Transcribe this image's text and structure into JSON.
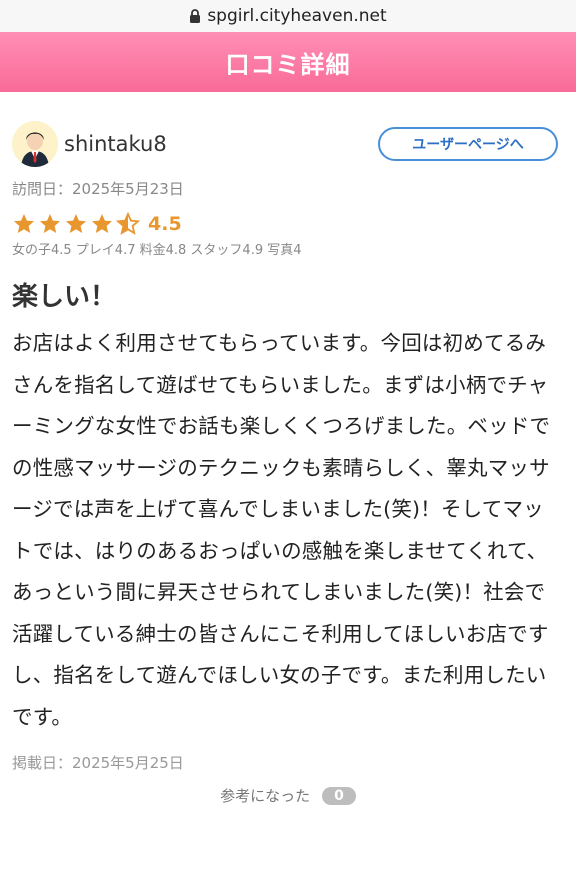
{
  "browser": {
    "url": "spgirl.cityheaven.net"
  },
  "header": {
    "title": "口コミ詳細"
  },
  "review": {
    "username": "shintaku8",
    "userpage_button": "ユーザーページへ",
    "visit_date": "訪問日：2025年5月23日",
    "rating": "4.5",
    "rating_value": 4.5,
    "subscores": "女の子4.5 プレイ4.7 料金4.8 スタッフ4.9 写真4",
    "title": "楽しい！",
    "body": "お店はよく利用させてもらっています。今回は初めてるみさんを指名して遊ばせてもらいました。まずは小柄でチャーミングな女性でお話も楽しくくつろげました。ベッドでの性感マッサージのテクニックも素晴らしく、睾丸マッサージでは声を上げて喜んでしまいました(笑)！そしてマットでは、はりのあるおっぱいの感触を楽しませてくれて、あっという間に昇天させられてしまいました(笑)！社会で活躍している紳士の皆さんにこそ利用してほしいお店ですし、指名をして遊んでほしい女の子です。また利用したいです。",
    "posted_date": "掲載日：2025年5月25日",
    "helpful_label": "参考になった",
    "helpful_count": "0"
  },
  "colors": {
    "header": "#f96a98",
    "star": "#e8962e",
    "button_border": "#4a90d9"
  }
}
